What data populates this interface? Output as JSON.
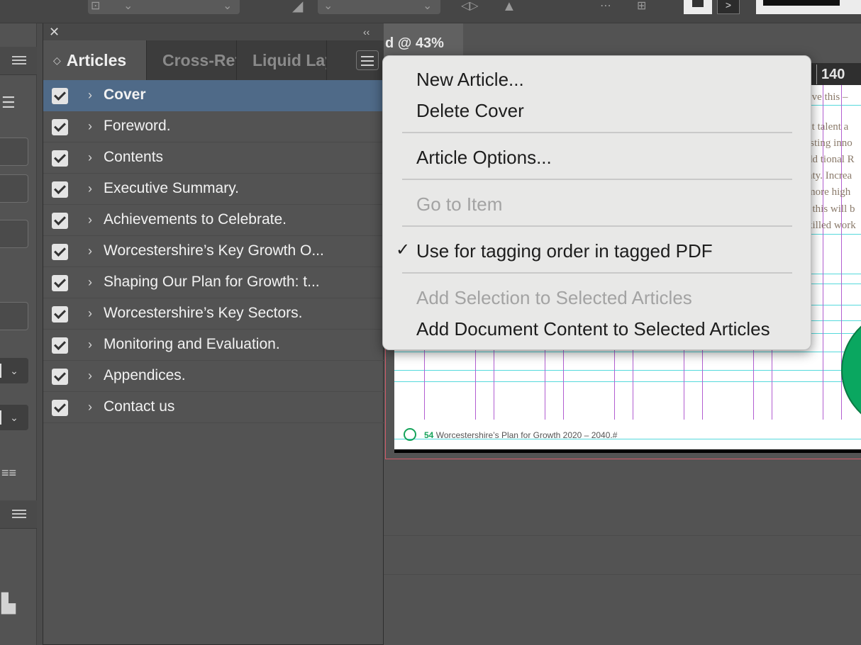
{
  "document": {
    "tab_label": "d @ 43%",
    "ruler_number": "140",
    "body_text_fragments": [
      "eve this –",
      "at talent a",
      "isting inno",
      "dd tional R",
      "nty. Increa",
      "more high",
      ", this will b",
      "killed work"
    ],
    "footer_page_number": "54",
    "footer_text": "Worcestershire’s Plan for Growth 2020 – 2040.#",
    "accent_color": "#0aa760"
  },
  "panel": {
    "close_glyph": "✕",
    "collapse_glyph": "‹‹",
    "tabs": [
      {
        "label": "Articles",
        "active": true
      },
      {
        "label": "Cross-References",
        "active": false
      },
      {
        "label": "Liquid Layout",
        "active": false
      }
    ],
    "tab_order_glyph": "◇",
    "articles": [
      {
        "label": "Cover",
        "checked": true,
        "selected": true
      },
      {
        "label": "Foreword.",
        "checked": true
      },
      {
        "label": "Contents",
        "checked": true
      },
      {
        "label": "Executive Summary.",
        "checked": true
      },
      {
        "label": "Achievements to Celebrate.",
        "checked": true
      },
      {
        "label": "Worcestershire’s Key Growth O...",
        "checked": true
      },
      {
        "label": "Shaping Our Plan for Growth: t...",
        "checked": true
      },
      {
        "label": "Worcestershire’s Key Sectors.",
        "checked": true
      },
      {
        "label": "Monitoring and Evaluation.",
        "checked": true
      },
      {
        "label": "Appendices.",
        "checked": true
      },
      {
        "label": "Contact us",
        "checked": true
      }
    ],
    "chevron_glyph": "›",
    "selection_color": "#4f6a88"
  },
  "context_menu": {
    "items": [
      {
        "label": "New Article...",
        "enabled": true
      },
      {
        "label": "Delete Cover",
        "enabled": true
      },
      {
        "label": "Article Options...",
        "enabled": true
      },
      {
        "label": "Go to Item",
        "enabled": false
      },
      {
        "label": "Use for tagging order in tagged PDF",
        "enabled": true,
        "checked": true
      },
      {
        "label": "Add Selection to Selected Articles",
        "enabled": false
      },
      {
        "label": "Add Document Content to Selected Articles",
        "enabled": true
      }
    ],
    "check_glyph": "✓"
  },
  "toolbar": {
    "dropdown_glyph": "⌄",
    "right_arrow_glyph": ">"
  }
}
